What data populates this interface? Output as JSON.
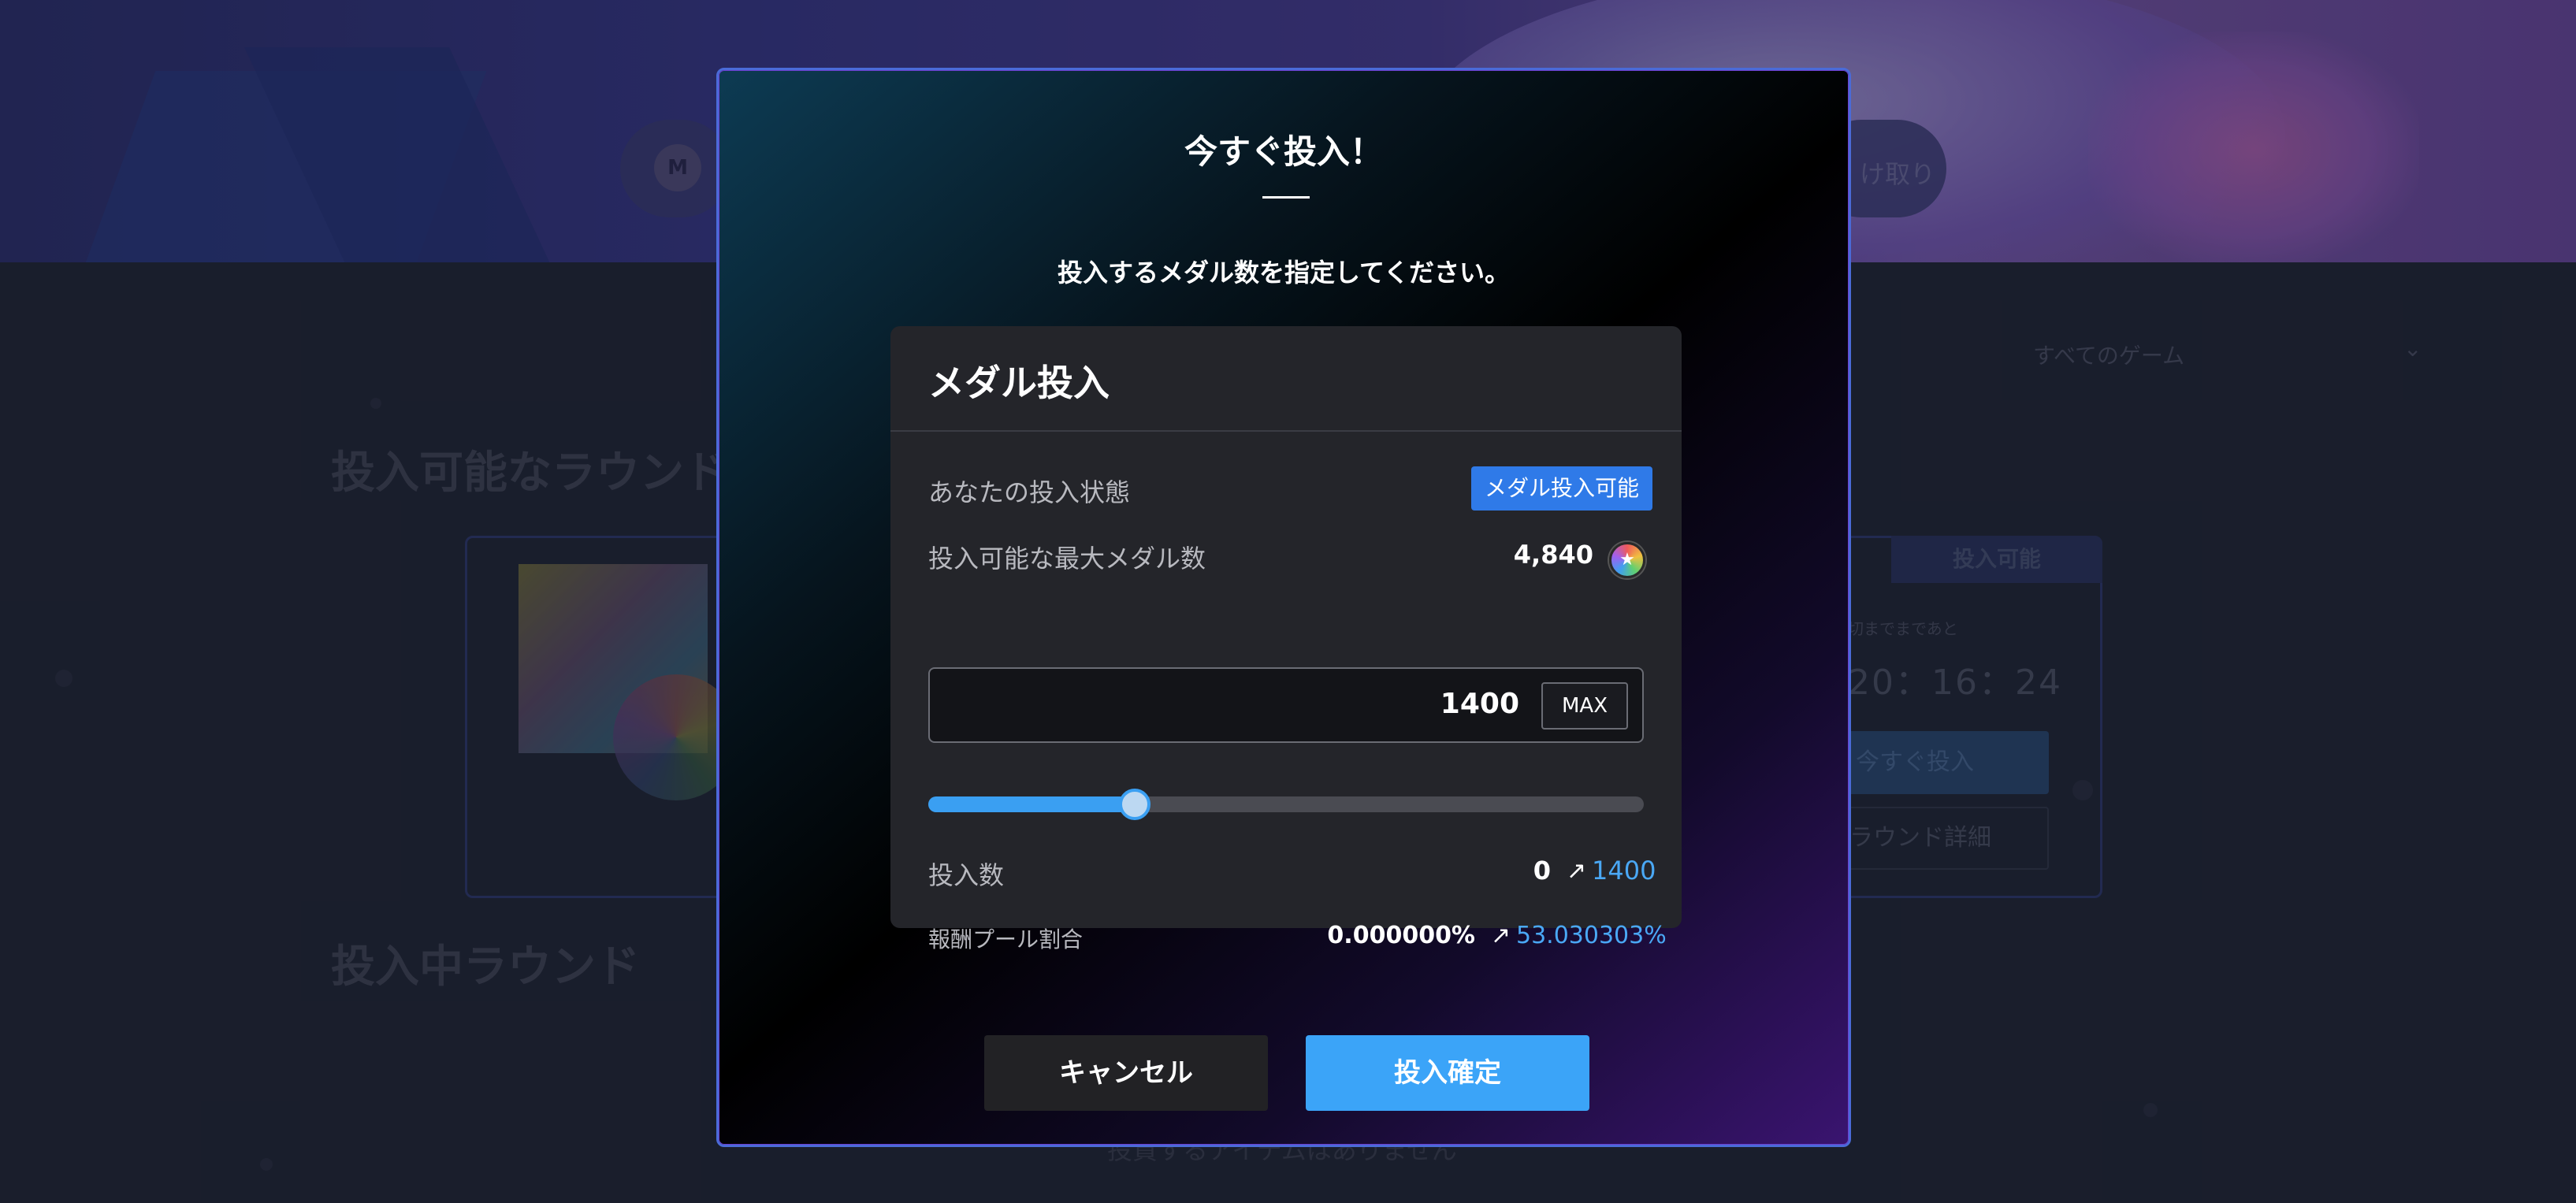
{
  "background": {
    "header_right_button_text": "け取り",
    "game_filter": "すべてのゲーム",
    "section_available_title": "投入可能なラウンド",
    "section_invested_title": "投入中ラウンド",
    "card_status_tag": "投入可能",
    "card_until_label": "切までまであと",
    "card_timer": "20：16：24",
    "card_invest_button": "今すぐ投入",
    "card_detail_button": "ラウンド詳細",
    "empty_message": "投資するアイテムはありません"
  },
  "modal": {
    "title": "今すぐ投入！",
    "subtitle": "投入するメダル数を指定してください。",
    "panel_title": "メダル投入",
    "status_label": "あなたの投入状態",
    "status_badge": "メダル投入可能",
    "max_label": "投入可能な最大メダル数",
    "max_value": "4,840",
    "amount_value": "1400",
    "max_button": "MAX",
    "slider_fraction": 0.289,
    "invest_count_label": "投入数",
    "invest_count_before": "0",
    "invest_count_after": "1400",
    "ratio_label": "報酬プール割合",
    "ratio_before": "0.000000%",
    "ratio_after": "53.030303%",
    "arrow_glyph": "↗",
    "cancel_button": "キャンセル",
    "confirm_button": "投入確定"
  },
  "icons": {
    "medal": "medal-icon",
    "pouch": "coin-pouch-icon",
    "chevron": "chevron-down-icon"
  },
  "colors": {
    "accent_blue": "#3ba4f8",
    "status_badge_blue": "#2f7ae8",
    "modal_border": "#4a6bd8"
  }
}
